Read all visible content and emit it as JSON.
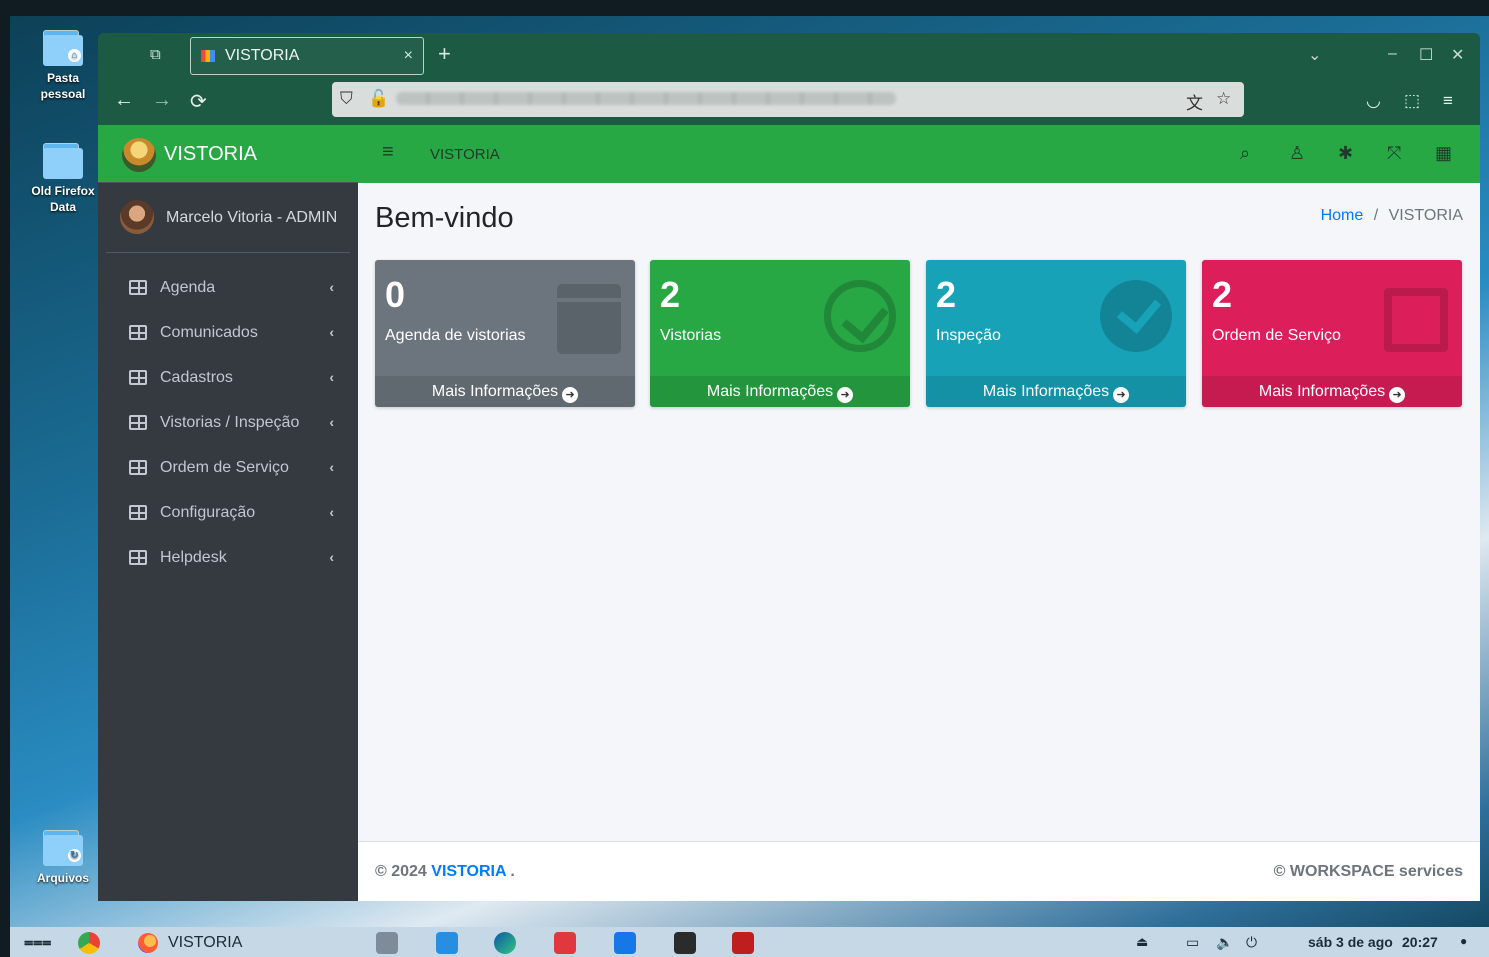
{
  "desktop": {
    "icons": [
      {
        "label_line1": "Pasta",
        "label_line2": "pessoal"
      },
      {
        "label_line1": "Old Firefox",
        "label_line2": "Data"
      },
      {
        "label_line1": "Arquivos",
        "label_line2": ""
      }
    ]
  },
  "browser": {
    "tab_title": "VISTORIA",
    "new_tab_symbol": "+",
    "tab_close": "×",
    "window_controls": [
      "⌄",
      "–",
      "☐",
      "✕"
    ],
    "nav": {
      "back": "←",
      "forward": "→",
      "reload": "⟳"
    }
  },
  "app": {
    "brand": "VISTORIA",
    "user_name": "Marcelo Vitoria - ADMIN",
    "menu": [
      {
        "label": "Agenda"
      },
      {
        "label": "Comunicados"
      },
      {
        "label": "Cadastros"
      },
      {
        "label": "Vistorias / Inspeção"
      },
      {
        "label": "Ordem de Serviço"
      },
      {
        "label": "Configuração"
      },
      {
        "label": "Helpdesk"
      }
    ],
    "topbar_title": "VISTORIA",
    "page_title": "Bem-vindo",
    "breadcrumb": {
      "home": "Home",
      "sep": "/",
      "current": "VISTORIA"
    },
    "boxes": [
      {
        "count": "0",
        "label": "Agenda de vistorias",
        "more": "Mais Informações",
        "color": "#6c757d"
      },
      {
        "count": "2",
        "label": "Vistorias",
        "more": "Mais Informações",
        "color": "#28a745"
      },
      {
        "count": "2",
        "label": "Inspeção",
        "more": "Mais Informações",
        "color": "#17a2b8"
      },
      {
        "count": "2",
        "label": "Ordem de Serviço",
        "more": "Mais Informações",
        "color": "#dc1f5a"
      }
    ],
    "footer": {
      "copyright": "© 2024",
      "brand": "VISTORIA",
      "dot": ".",
      "right": "© WORKSPACE services"
    }
  },
  "taskbar": {
    "active_window": "VISTORIA",
    "date": "sáb 3 de ago",
    "time": "20:27"
  }
}
